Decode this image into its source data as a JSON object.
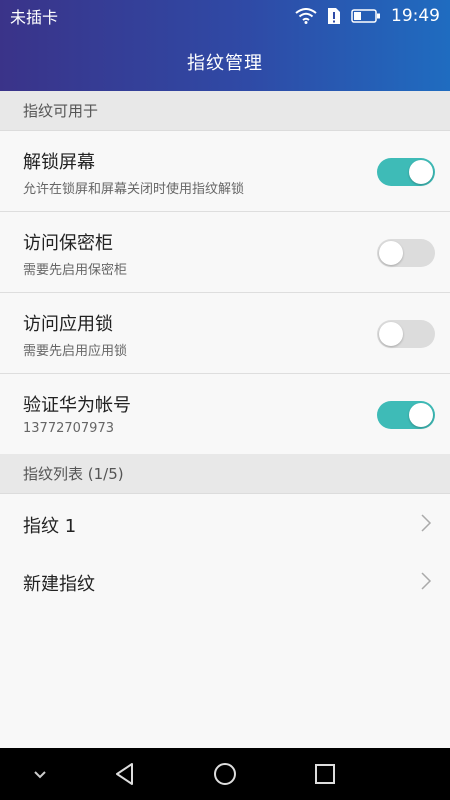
{
  "status": {
    "carrier": "未插卡",
    "time": "19:49"
  },
  "title": "指纹管理",
  "section_usage": "指纹可用于",
  "toggles": [
    {
      "title": "解锁屏幕",
      "subtitle": "允许在锁屏和屏幕关闭时使用指纹解锁",
      "on": true
    },
    {
      "title": "访问保密柜",
      "subtitle": "需要先启用保密柜",
      "on": false
    },
    {
      "title": "访问应用锁",
      "subtitle": "需要先启用应用锁",
      "on": false
    },
    {
      "title": "验证华为帐号",
      "subtitle": "13772707973",
      "on": true
    }
  ],
  "section_list": "指纹列表 (1/5)",
  "fingerprints": [
    {
      "label": "指纹 1"
    },
    {
      "label": "新建指纹"
    }
  ],
  "colors": {
    "accent": "#3ebbb7",
    "header_start": "#3a3389",
    "header_end": "#1f6cc0"
  }
}
